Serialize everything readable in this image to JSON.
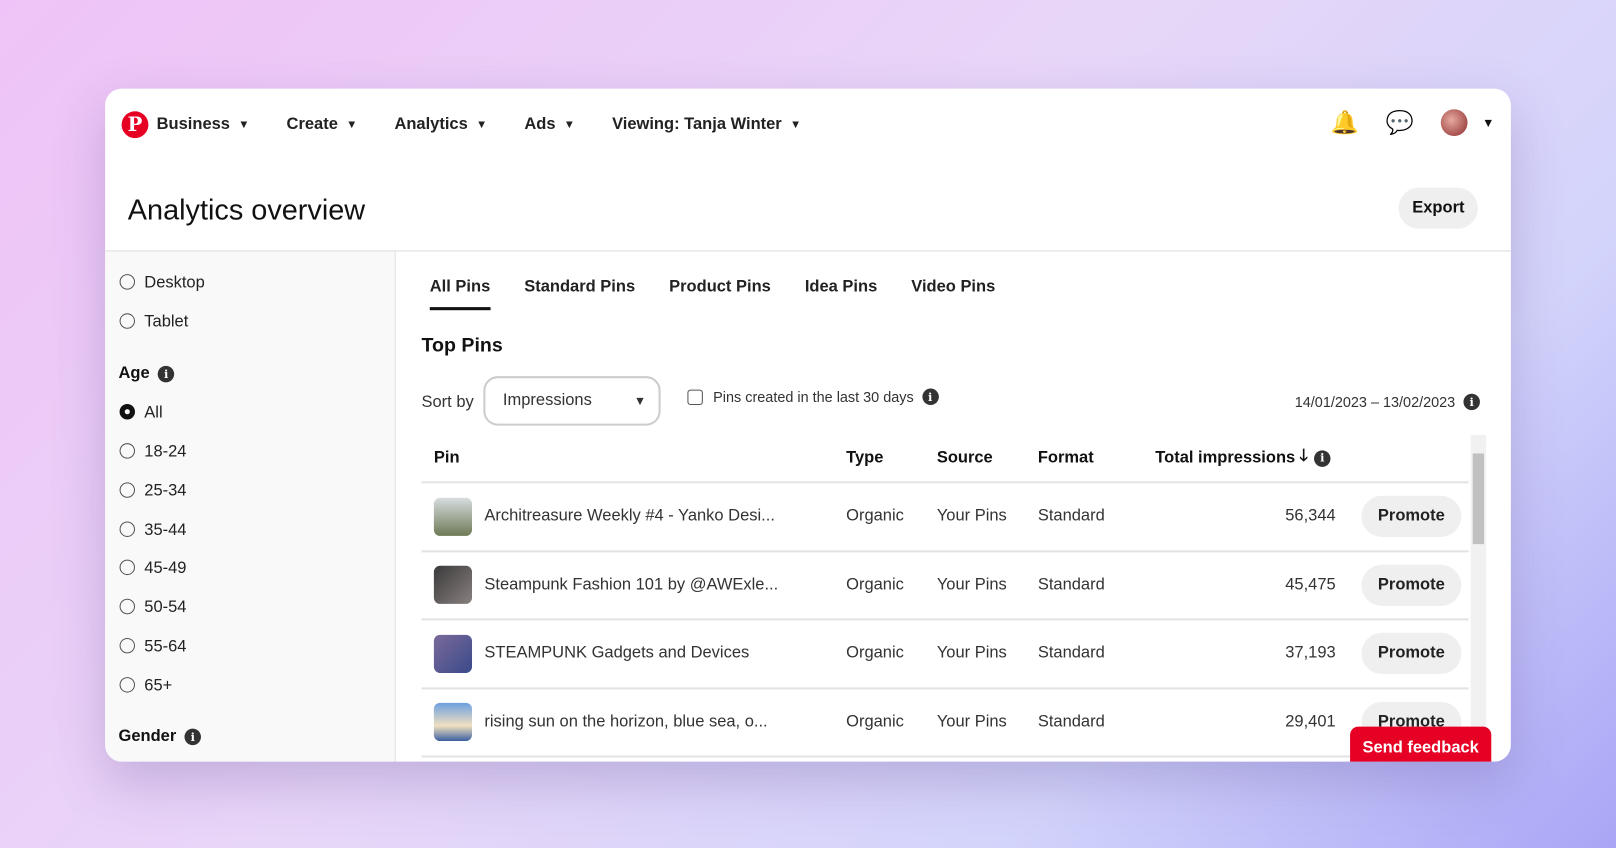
{
  "nav": {
    "items": [
      {
        "label": "Business"
      },
      {
        "label": "Create"
      },
      {
        "label": "Analytics"
      },
      {
        "label": "Ads"
      },
      {
        "label": "Viewing: Tanja Winter"
      }
    ],
    "logo": "P"
  },
  "header": {
    "title": "Analytics overview",
    "export": "Export"
  },
  "sidebar": {
    "device_options": [
      {
        "label": "Desktop",
        "selected": false
      },
      {
        "label": "Tablet",
        "selected": false
      }
    ],
    "age_heading": "Age",
    "age_options": [
      {
        "label": "All",
        "selected": true
      },
      {
        "label": "18-24"
      },
      {
        "label": "25-34"
      },
      {
        "label": "35-44"
      },
      {
        "label": "45-49"
      },
      {
        "label": "50-54"
      },
      {
        "label": "55-64"
      },
      {
        "label": "65+"
      }
    ],
    "gender_heading": "Gender"
  },
  "tabs": [
    {
      "label": "All Pins",
      "active": true
    },
    {
      "label": "Standard Pins"
    },
    {
      "label": "Product Pins"
    },
    {
      "label": "Idea Pins"
    },
    {
      "label": "Video Pins"
    }
  ],
  "top_pins": {
    "title": "Top Pins",
    "sort_label": "Sort by",
    "sort_value": "Impressions",
    "checkbox_label": "Pins created in the last 30 days",
    "checkbox_checked": false,
    "date_range": "14/01/2023 – 13/02/2023"
  },
  "table": {
    "headers": {
      "pin": "Pin",
      "type": "Type",
      "source": "Source",
      "format": "Format",
      "impressions": "Total impressions"
    },
    "rows": [
      {
        "title": "Architreasure Weekly #4 - Yanko Desi...",
        "type": "Organic",
        "source": "Your Pins",
        "format": "Standard",
        "impressions": "56,344",
        "action": "Promote"
      },
      {
        "title": "Steampunk Fashion 101 by @AWExle...",
        "type": "Organic",
        "source": "Your Pins",
        "format": "Standard",
        "impressions": "45,475",
        "action": "Promote"
      },
      {
        "title": "STEAMPUNK Gadgets and Devices",
        "type": "Organic",
        "source": "Your Pins",
        "format": "Standard",
        "impressions": "37,193",
        "action": "Promote"
      },
      {
        "title": "rising sun on the horizon, blue sea, o...",
        "type": "Organic",
        "source": "Your Pins",
        "format": "Standard",
        "impressions": "29,401",
        "action": "Promote"
      }
    ]
  },
  "feedback": "Send feedback",
  "colors": {
    "brand": "#e60023"
  }
}
